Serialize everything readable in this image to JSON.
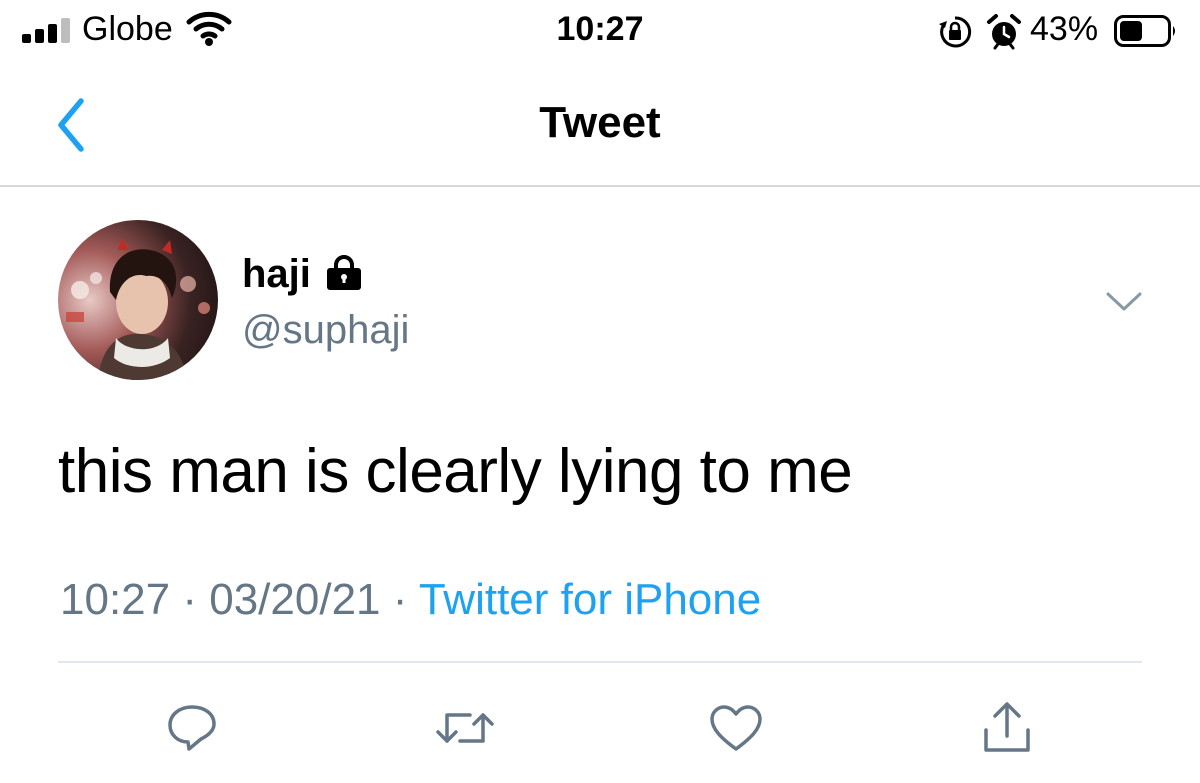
{
  "status_bar": {
    "carrier": "Globe",
    "time": "10:27",
    "battery_percent": "43%",
    "signal_bars": 3,
    "battery_level": 0.43,
    "icons": [
      "signal-icon",
      "wifi-icon",
      "rotation-lock-icon",
      "alarm-icon",
      "battery-icon"
    ]
  },
  "nav": {
    "title": "Tweet",
    "back_icon": "chevron-left-icon",
    "accent_color": "#1da1f2"
  },
  "tweet": {
    "display_name": "haji",
    "protected_icon": "lock-icon",
    "username": "@suphaji",
    "text": "this man is clearly lying to me",
    "time": "10:27",
    "separator": "·",
    "date": "03/20/21",
    "source": "Twitter for iPhone",
    "menu_icon": "chevron-down-icon"
  },
  "actions": [
    {
      "name": "reply",
      "icon": "reply-icon"
    },
    {
      "name": "retweet",
      "icon": "retweet-icon"
    },
    {
      "name": "like",
      "icon": "heart-icon"
    },
    {
      "name": "share",
      "icon": "share-icon"
    }
  ],
  "colors": {
    "muted_text": "#657786",
    "link": "#1da1f2",
    "divider": "#e1e8ed"
  }
}
